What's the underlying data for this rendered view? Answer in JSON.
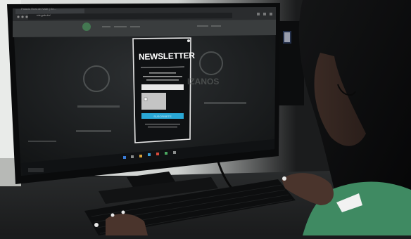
{
  "browser": {
    "tab_title": "Palacio Real del Valle | En...",
    "url": "rdv.gob.do/"
  },
  "background_page": {
    "headline_fragment": "IZANOS"
  },
  "popup": {
    "title": "NEWSLETTER",
    "cta_label": "SUSCRIBETE"
  },
  "colors": {
    "popup_bg": "#0f1113",
    "popup_border": "#e6e6e6",
    "cta_blue": "#2aa8d6",
    "shirt_green": "#3f8a62",
    "logo_green": "#4aa860"
  }
}
